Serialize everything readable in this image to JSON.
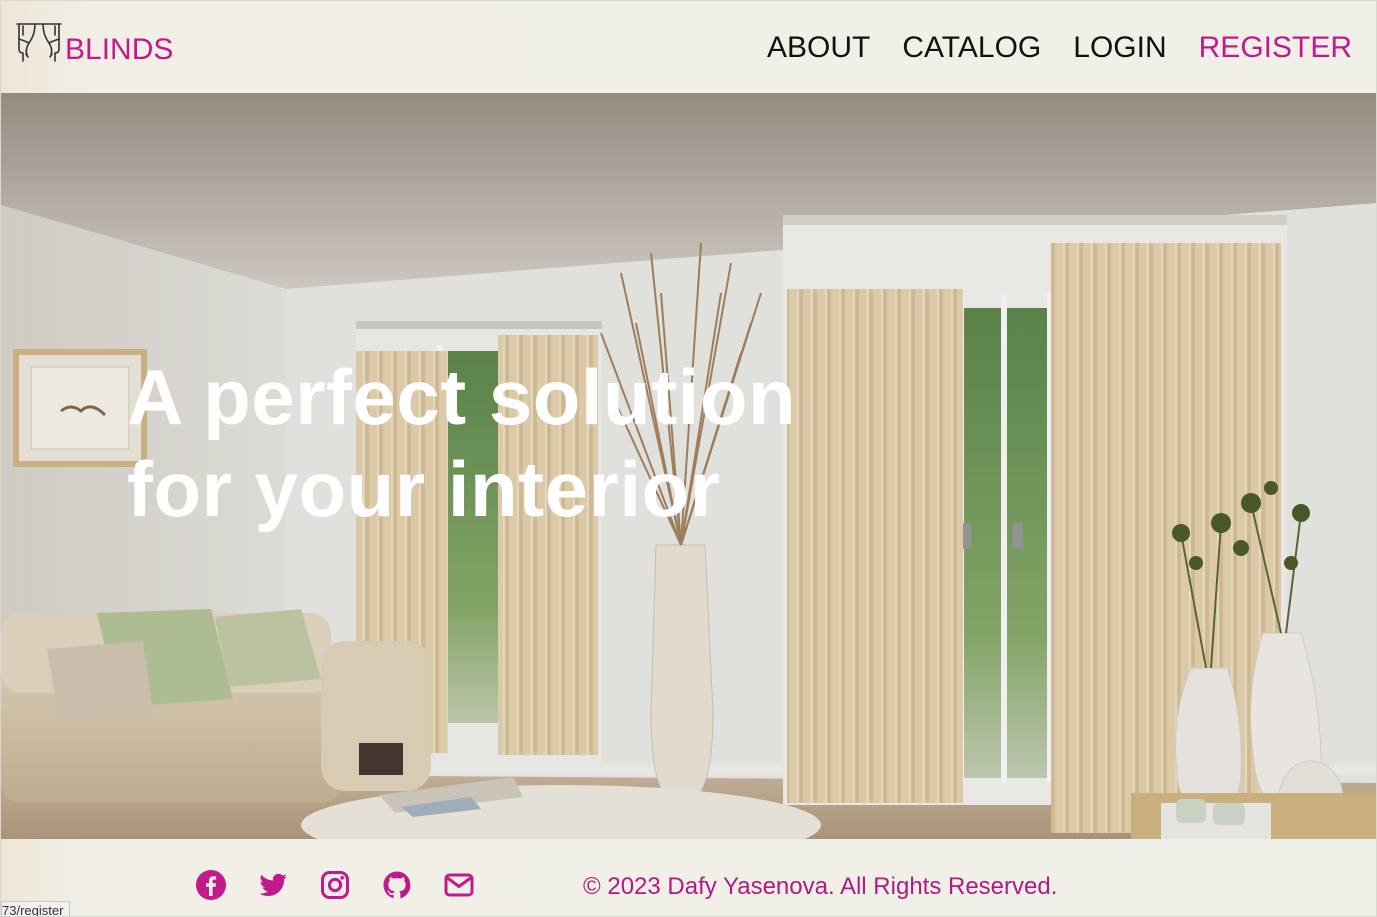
{
  "brand": {
    "name": "BLINDS",
    "icon": "curtains-icon",
    "accent_color": "#c21a8c"
  },
  "nav": {
    "items": [
      {
        "label": "ABOUT",
        "active": false
      },
      {
        "label": "CATALOG",
        "active": false
      },
      {
        "label": "LOGIN",
        "active": false
      },
      {
        "label": "REGISTER",
        "active": true
      }
    ]
  },
  "hero": {
    "title": "A perfect solution for your interior",
    "image": "living-room-with-vertical-blinds"
  },
  "footer": {
    "social": [
      {
        "icon": "facebook-icon"
      },
      {
        "icon": "twitter-icon"
      },
      {
        "icon": "instagram-icon"
      },
      {
        "icon": "github-icon"
      },
      {
        "icon": "mail-icon"
      }
    ],
    "copyright": "© 2023 Dafy Yasenova. All Rights Reserved."
  },
  "status_bar": {
    "url": "73/register"
  }
}
